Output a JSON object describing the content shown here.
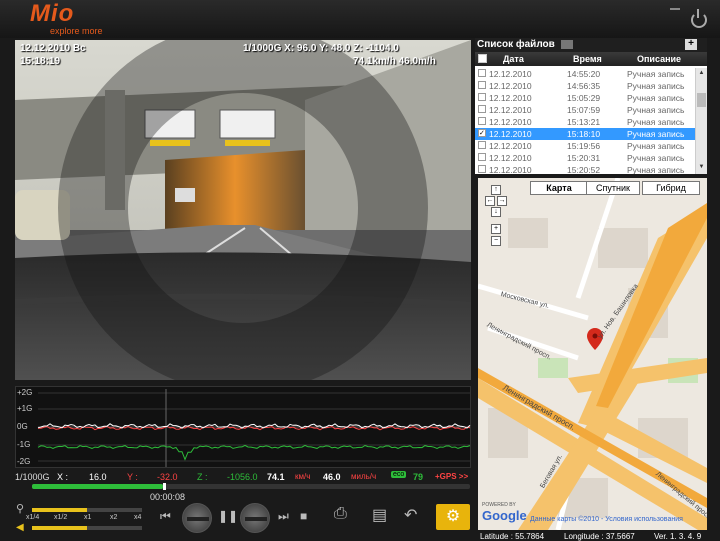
{
  "header": {
    "logo_main": "Mio",
    "logo_tagline": "explore more"
  },
  "video": {
    "date": "12.12.2010 Вс",
    "time": "15:18:19",
    "accel_info": "1/1000G  X:  96.0  Y:  48.0  Z: -1104.0",
    "gps_info": "74.1km/h 46.0m/h"
  },
  "graph": {
    "labels": [
      "+2G",
      "+1G",
      "0G",
      "-1G",
      "-2G"
    ]
  },
  "readout": {
    "scale": "1/1000G",
    "x_label": "X :",
    "x_value": "16.0",
    "y_label": "Y :",
    "y_value": "-32.0",
    "z_label": "Z :",
    "z_value": "-1056.0",
    "speed_kmh": "74.1",
    "unit_kmh": "км/ч",
    "speed_mph": "46.0",
    "unit_mph": "миль/ч",
    "eco_label": "eco",
    "eco_value": "79",
    "gps_label": "+GPS >>",
    "colors": {
      "x": "#ffffff",
      "y": "#ff4444",
      "z": "#2ebd3a"
    }
  },
  "playback": {
    "current_time": "00:00:08",
    "progress": 0.3,
    "speed_labels": [
      "x1/4",
      "x1/2",
      "x1",
      "x2",
      "x4"
    ],
    "speed_value": 0.5,
    "volume_value": 0.5
  },
  "files": {
    "title": "Список файлов",
    "columns": [
      "Дата",
      "Время",
      "Описание"
    ],
    "rows": [
      {
        "date": "12.12.2010",
        "time": "14:55:20",
        "desc": "Ручная запись",
        "checked": false,
        "selected": false
      },
      {
        "date": "12.12.2010",
        "time": "14:56:35",
        "desc": "Ручная запись",
        "checked": false,
        "selected": false
      },
      {
        "date": "12.12.2010",
        "time": "15:05:29",
        "desc": "Ручная запись",
        "checked": false,
        "selected": false
      },
      {
        "date": "12.12.2010",
        "time": "15:07:59",
        "desc": "Ручная запись",
        "checked": false,
        "selected": false
      },
      {
        "date": "12.12.2010",
        "time": "15:13:21",
        "desc": "Ручная запись",
        "checked": false,
        "selected": false
      },
      {
        "date": "12.12.2010",
        "time": "15:18:10",
        "desc": "Ручная запись",
        "checked": true,
        "selected": true
      },
      {
        "date": "12.12.2010",
        "time": "15:19:56",
        "desc": "Ручная запись",
        "checked": false,
        "selected": false
      },
      {
        "date": "12.12.2010",
        "time": "15:20:31",
        "desc": "Ручная запись",
        "checked": false,
        "selected": false
      },
      {
        "date": "12.12.2010",
        "time": "15:20:52",
        "desc": "Ручная запись",
        "checked": false,
        "selected": false
      }
    ]
  },
  "map": {
    "tabs": [
      "Карта",
      "Спутник",
      "Гибрид"
    ],
    "streets": [
      "Московская ул.",
      "ул. Нов. Башиловка",
      "Ленинградский просп.",
      "Ленинградский просп.",
      "Беговая ул.",
      "Ленинградский просп."
    ],
    "attribution": "Данные карты ©2010 - Условия использования",
    "google": "Google",
    "powered": "POWERED BY"
  },
  "status": {
    "latitude": "Latitude : 55.7864",
    "longitude": "Longitude : 37.5667",
    "version": "Ver. 1. 3. 4. 9"
  }
}
